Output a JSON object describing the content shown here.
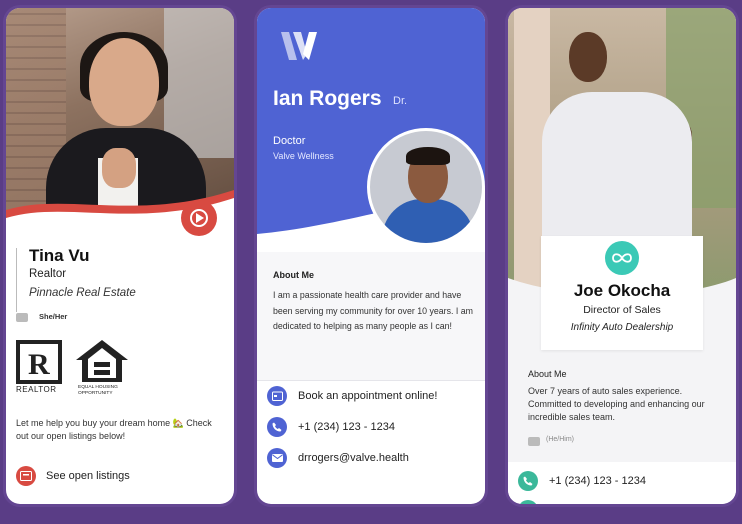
{
  "background_color": "#5a3d86",
  "cards": [
    {
      "name": "Tina Vu",
      "title": "Realtor",
      "company": "Pinnacle Real Estate",
      "pronouns": "She/Her",
      "realtor_label": "REALTOR",
      "eho_label": "EQUAL HOUSING OPPORTUNITY",
      "description": "Let me help you buy your dream home 🏡 Check out our open listings below!",
      "cta": "See open listings",
      "accent": "#d84a41"
    },
    {
      "name": "Ian Rogers",
      "suffix": "Dr.",
      "title": "Doctor",
      "company": "Valve Wellness",
      "about_heading": "About Me",
      "about": "I am a passionate health care provider and have been serving my community for over 10 years. I am dedicated to helping as many people as I can!",
      "actions": [
        {
          "icon": "calendar-icon",
          "label": "Book an appointment online!"
        },
        {
          "icon": "phone-icon",
          "label": "+1 (234) 123 - 1234"
        },
        {
          "icon": "email-icon",
          "label": "drrogers@valve.health"
        }
      ],
      "accent": "#4f63d3"
    },
    {
      "name": "Joe Okocha",
      "title": "Director of Sales",
      "company": "Infinity Auto Dealership",
      "about_heading": "About Me",
      "about": "Over 7 years of auto sales experience. Committed to developing and enhancing our incredible sales team.",
      "pronouns": "(He/Him)",
      "actions": [
        {
          "icon": "phone-icon",
          "label": "+1 (234) 123 - 1234"
        }
      ],
      "accent": "#3bb89a"
    }
  ]
}
